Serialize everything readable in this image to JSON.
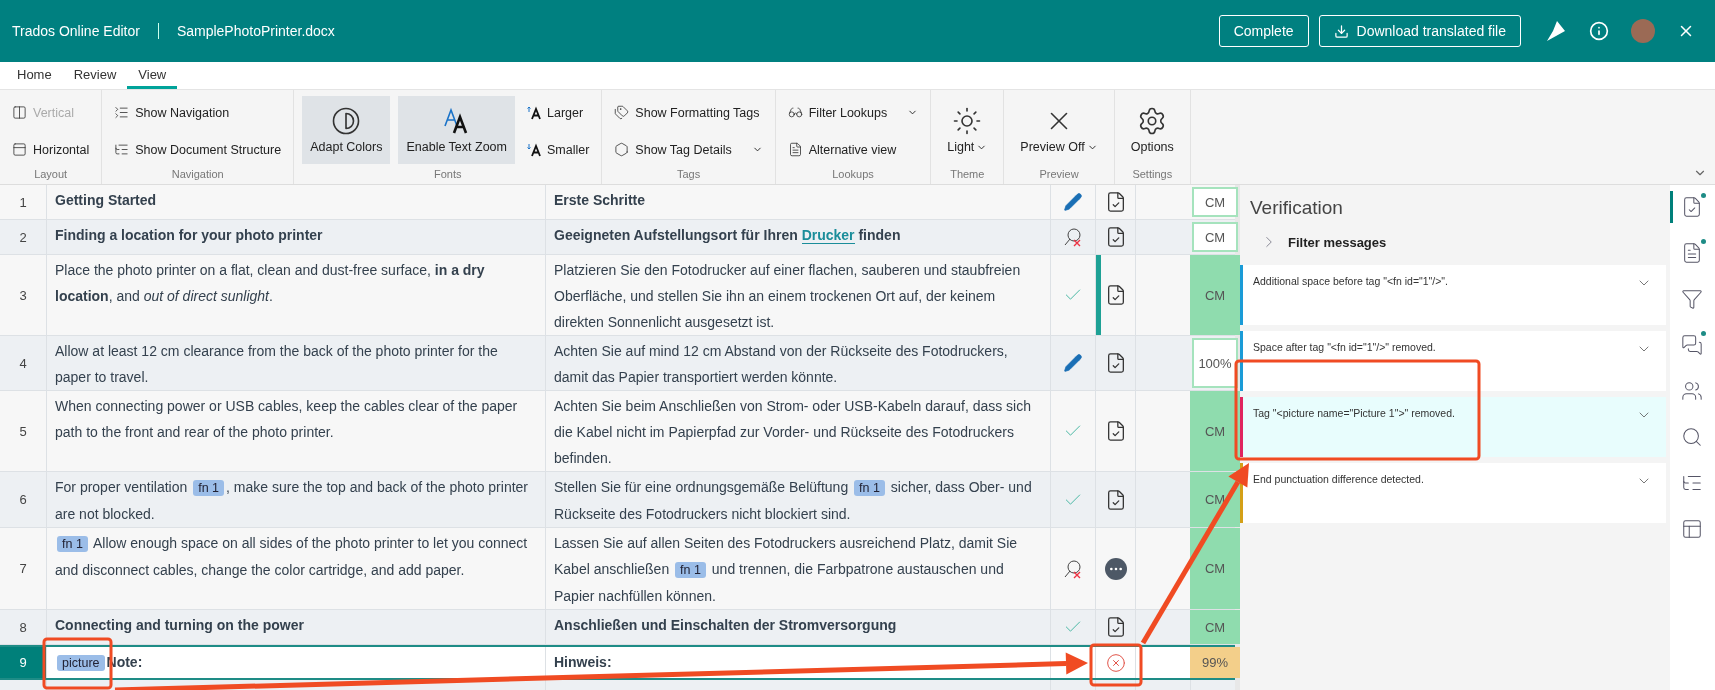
{
  "header": {
    "app_name": "Trados Online Editor",
    "file_name": "SamplePhotoPrinter.docx",
    "buttons": [
      {
        "label": "Complete",
        "kind": "plain"
      },
      {
        "label": "Download translated file",
        "kind": "download"
      }
    ]
  },
  "tabs": [
    {
      "label": "Home",
      "selected": false
    },
    {
      "label": "Review",
      "selected": false
    },
    {
      "label": "View",
      "selected": true
    }
  ],
  "ribbon": [
    {
      "label": "Layout",
      "items": [
        {
          "label": "Vertical",
          "kind": "small",
          "disabled": true
        },
        {
          "label": "Horizontal",
          "kind": "small",
          "disabled": false
        }
      ]
    },
    {
      "label": "Navigation",
      "items": [
        {
          "label": "Show Navigation",
          "kind": "small",
          "disabled": false
        },
        {
          "label": "Show Document Structure",
          "kind": "small",
          "disabled": false
        }
      ]
    },
    {
      "label": "Fonts",
      "items": [
        {
          "label": "Adapt Colors",
          "kind": "large",
          "selected": true
        },
        {
          "label": "Enable Text Zoom",
          "kind": "large",
          "selected": true
        },
        {
          "label": "Larger",
          "kind": "small",
          "disabled": false
        },
        {
          "label": "Smaller",
          "kind": "small",
          "disabled": false
        }
      ]
    },
    {
      "label": "Tags",
      "items": [
        {
          "label": "Show Formatting Tags",
          "kind": "small",
          "disabled": false
        },
        {
          "label": "Show Tag Details",
          "kind": "small",
          "disabled": false,
          "dropdown": true
        }
      ]
    },
    {
      "label": "Lookups",
      "items": [
        {
          "label": "Filter Lookups",
          "kind": "small",
          "disabled": false,
          "dropdown": true
        },
        {
          "label": "Alternative view",
          "kind": "small",
          "disabled": false
        }
      ]
    },
    {
      "label": "Theme",
      "items": [
        {
          "label": "Light",
          "kind": "large",
          "selected": false,
          "dropdown": true
        }
      ]
    },
    {
      "label": "Preview",
      "items": [
        {
          "label": "Preview Off",
          "kind": "large",
          "selected": false,
          "dropdown": true
        }
      ]
    },
    {
      "label": "Settings",
      "items": [
        {
          "label": "Options",
          "kind": "large",
          "selected": false
        }
      ]
    }
  ],
  "segments": [
    {
      "number": "1",
      "heading": true,
      "selected": false,
      "source": [
        {
          "kind": "text",
          "text": "Getting Started"
        }
      ],
      "target": [
        {
          "kind": "text",
          "text": "Erste Schritte"
        }
      ],
      "status": {
        "kind": "edited"
      },
      "document": {
        "kind": "confirmed"
      },
      "change_bar": false,
      "match": {
        "text": "CM",
        "kind": "outlined"
      }
    },
    {
      "number": "2",
      "heading": true,
      "selected": false,
      "source": [
        {
          "kind": "text",
          "text": "Finding a location for your photo printer"
        }
      ],
      "target": [
        {
          "kind": "text",
          "text": "Geeigneten Aufstellungsort für Ihren "
        },
        {
          "kind": "term",
          "text": "Drucker"
        },
        {
          "kind": "text",
          "text": " finden"
        }
      ],
      "status": {
        "kind": "rejected"
      },
      "document": {
        "kind": "confirmed"
      },
      "change_bar": false,
      "match": {
        "text": "CM",
        "kind": "outlined"
      }
    },
    {
      "number": "3",
      "heading": false,
      "selected": false,
      "source": [
        {
          "kind": "text",
          "text": "Place the photo printer on a flat, clean and dust-free surface, **in a dry location**, and *out of direct sunlight*."
        }
      ],
      "target": [
        {
          "kind": "text",
          "text": "Platzieren Sie den Fotodrucker auf einer flachen, sauberen und staubfreien Oberfläche, und stellen Sie ihn an einem trockenen Ort auf, der keinem direkten Sonnenlicht ausgesetzt ist."
        }
      ],
      "status": {
        "kind": "confirmed"
      },
      "document": {
        "kind": "confirmed"
      },
      "change_bar": true,
      "match": {
        "text": "CM",
        "kind": "filled"
      }
    },
    {
      "number": "4",
      "heading": false,
      "selected": false,
      "source": [
        {
          "kind": "text",
          "text": "Allow at least 12 cm clearance from the back of the photo printer for the paper to travel."
        }
      ],
      "target": [
        {
          "kind": "text",
          "text": "Achten Sie auf mind 12 cm Abstand von der Rückseite des Fotodruckers, damit das Papier transportiert werden könnte."
        }
      ],
      "status": {
        "kind": "edited"
      },
      "document": {
        "kind": "confirmed"
      },
      "change_bar": false,
      "match": {
        "text": "100%",
        "kind": "outlined"
      }
    },
    {
      "number": "5",
      "heading": false,
      "selected": false,
      "source": [
        {
          "kind": "text",
          "text": "When connecting power or USB cables, keep the cables clear of the paper path to the front and rear of the photo printer."
        }
      ],
      "target": [
        {
          "kind": "text",
          "text": "Achten Sie beim Anschließen von Strom- oder USB-Kabeln darauf, dass sich die Kabel nicht im Papierpfad zur Vorder- und Rückseite des Fotodruckers befinden."
        }
      ],
      "status": {
        "kind": "confirmed"
      },
      "document": {
        "kind": "confirmed"
      },
      "change_bar": false,
      "match": {
        "text": "CM",
        "kind": "filled"
      }
    },
    {
      "number": "6",
      "heading": false,
      "selected": false,
      "source": [
        {
          "kind": "text",
          "text": "For proper ventilation "
        },
        {
          "kind": "tag",
          "text": "fn 1"
        },
        {
          "kind": "text",
          "text": ", make sure the top and back of the photo printer are not blocked."
        }
      ],
      "target": [
        {
          "kind": "text",
          "text": "Stellen Sie für eine ordnungsgemäße Belüftung "
        },
        {
          "kind": "tag",
          "text": "fn 1"
        },
        {
          "kind": "text",
          "text": " sicher, dass Ober- und Rückseite des Fotodruckers nicht blockiert sind."
        }
      ],
      "status": {
        "kind": "confirmed"
      },
      "document": {
        "kind": "confirmed"
      },
      "change_bar": false,
      "match": {
        "text": "CM",
        "kind": "filled"
      }
    },
    {
      "number": "7",
      "heading": false,
      "selected": false,
      "source": [
        {
          "kind": "tag",
          "text": "fn 1"
        },
        {
          "kind": "text",
          "text": " Allow enough space on all sides of the photo printer to let you connect and disconnect cables, change the color cartridge, and add paper."
        }
      ],
      "target": [
        {
          "kind": "text",
          "text": "Lassen Sie auf allen Seiten des Fotodruckers ausreichend Platz, damit Sie Kabel anschließen "
        },
        {
          "kind": "tag",
          "text": "fn 1"
        },
        {
          "kind": "text",
          "text": " und trennen, die Farbpatrone austauschen und Papier nachfüllen können."
        }
      ],
      "status": {
        "kind": "rejected"
      },
      "document": {
        "kind": "comment"
      },
      "change_bar": false,
      "match": {
        "text": "CM",
        "kind": "filled"
      }
    },
    {
      "number": "8",
      "heading": true,
      "selected": false,
      "source": [
        {
          "kind": "text",
          "text": "Connecting and turning on the power"
        }
      ],
      "target": [
        {
          "kind": "text",
          "text": "Anschließen und Einschalten der Stromversorgung"
        }
      ],
      "status": {
        "kind": "confirmed"
      },
      "document": {
        "kind": "confirmed"
      },
      "change_bar": false,
      "match": {
        "text": "CM",
        "kind": "filled"
      }
    },
    {
      "number": "9",
      "heading": true,
      "selected": true,
      "source": [
        {
          "kind": "tag",
          "text": "picture"
        },
        {
          "kind": "text",
          "text": "Note:"
        }
      ],
      "target": [
        {
          "kind": "text",
          "text": "Hinweis:"
        }
      ],
      "status": {
        "kind": "none"
      },
      "document": {
        "kind": "error"
      },
      "change_bar": false,
      "match": {
        "text": "99%",
        "kind": "fuzzy"
      }
    }
  ],
  "verification": {
    "title": "Verification",
    "filter_label": "Filter messages",
    "messages": [
      {
        "text": "Additional space before tag \"<fn id=\"1\"/>\".",
        "color": "#1a9bd7",
        "selected": false
      },
      {
        "text": "Space after tag \"<fn id=\"1\"/>\" removed.",
        "color": "#1a9bd7",
        "selected": false
      },
      {
        "text": "Tag \"<picture name=\"Picture 1\">\" removed.",
        "color": "#e0245e",
        "selected": true
      },
      {
        "text": "End punctuation difference detected.",
        "color": "#d4a017",
        "selected": false
      }
    ]
  },
  "side_rail": [
    {
      "selected": true,
      "badge": true
    },
    {
      "selected": false,
      "badge": true
    },
    {
      "selected": false,
      "badge": false
    },
    {
      "selected": false,
      "badge": true
    },
    {
      "selected": false,
      "badge": false
    },
    {
      "selected": false,
      "badge": false
    },
    {
      "selected": false,
      "badge": false
    },
    {
      "selected": false,
      "badge": false
    }
  ]
}
